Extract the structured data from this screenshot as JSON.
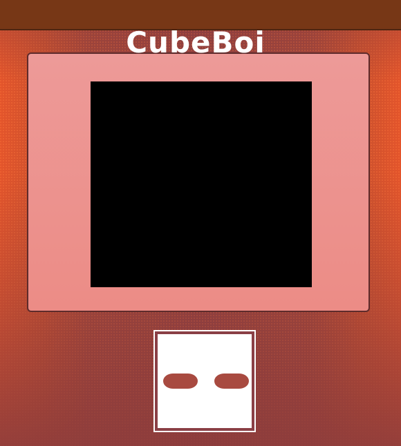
{
  "app": {
    "title": "CubeBoi"
  },
  "colors": {
    "top_bar": "#773716",
    "console_body": "#ed9a98",
    "screen": "#000000",
    "background_edge": "#e4552b",
    "background_center": "#8f4040",
    "buttons": "#a84a40",
    "pad_background": "#ffffff"
  },
  "controls": {
    "buttons": [
      "left-button",
      "right-button"
    ]
  }
}
